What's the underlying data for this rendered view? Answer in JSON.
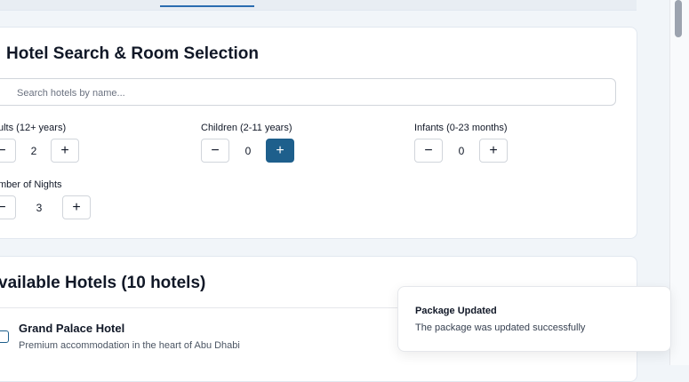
{
  "search_section": {
    "title": "Hotel Search & Room Selection",
    "search_placeholder": "Search hotels by name...",
    "adults": {
      "label": "ults (12+ years)",
      "value": "2",
      "minus": "−",
      "plus": "+"
    },
    "children": {
      "label": "Children (2-11 years)",
      "value": "0",
      "minus": "−",
      "plus": "+"
    },
    "infants": {
      "label": "Infants (0-23 months)",
      "value": "0",
      "minus": "−",
      "plus": "+"
    },
    "nights": {
      "label": "mber of Nights",
      "value": "3",
      "minus": "−",
      "plus": "+"
    }
  },
  "hotels_section": {
    "title": "vailable Hotels (10 hotels)",
    "items": [
      {
        "name": "Grand Palace Hotel",
        "description": "Premium accommodation in the heart of Abu Dhabi"
      }
    ]
  },
  "toast": {
    "title": "Package Updated",
    "message": "The package was updated successfully"
  },
  "colors": {
    "primary": "#1e5f8c",
    "background": "#f1f5f9",
    "card": "#ffffff"
  }
}
